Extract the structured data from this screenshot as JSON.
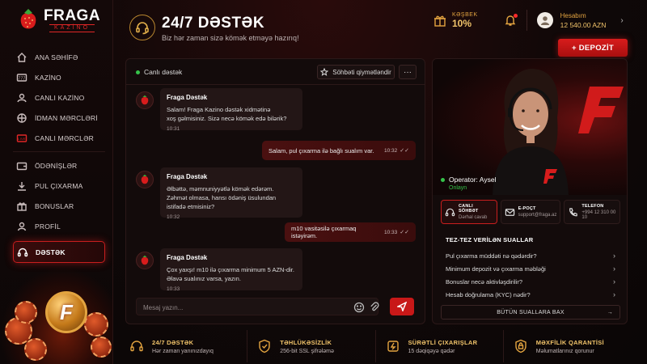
{
  "brand": {
    "name": "FRAGA",
    "sub": "KAZİNO"
  },
  "sidebar": {
    "items": [
      {
        "label": "ANA SƏHİFƏ",
        "icon": "home-icon"
      },
      {
        "label": "KAZİNO",
        "icon": "slot-icon"
      },
      {
        "label": "CANLI KAZİNO",
        "icon": "dealer-icon"
      },
      {
        "label": "İDMAN MƏRCLƏRİ",
        "icon": "sport-icon"
      },
      {
        "label": "CANLI MƏRCLƏR",
        "icon": "live-icon"
      },
      {
        "label": "ÖDƏNİŞLƏR",
        "icon": "wallet-icon"
      },
      {
        "label": "PUL ÇIXARMA",
        "icon": "withdraw-icon"
      },
      {
        "label": "BONUSLAR",
        "icon": "gift-icon"
      },
      {
        "label": "PROFİL",
        "icon": "user-icon"
      },
      {
        "label": "DƏSTƏK",
        "icon": "headset-icon"
      }
    ]
  },
  "header": {
    "title": "24/7 DƏSTƏK",
    "subtitle": "Biz hər zaman sizə kömək etməyə hazırıq!",
    "cashback_label": "KƏŞBEK",
    "cashback_value": "10%",
    "account_label": "Hesabım",
    "balance": "12 540.00 AZN",
    "deposit_label": "+ DEPOZİT"
  },
  "chat": {
    "status": "Canlı dəstək",
    "rate_label": "Söhbəti qiymətləndir",
    "more_label": "···",
    "messages": [
      {
        "from": "bot",
        "name": "Fraga Dəstək",
        "lines": [
          "Salam! Fraga Kazino dəstək xidmətinə",
          "xoş gəlmisiniz. Sizə necə kömək edə bilərik?"
        ],
        "time": "10:31"
      },
      {
        "from": "user",
        "text": "Salam, pul çıxarma ilə bağlı sualım var.",
        "time": "10:32"
      },
      {
        "from": "bot",
        "name": "Fraga Dəstək",
        "lines": [
          "Əlbəttə, məmnuniyyətlə kömək edərəm.",
          "Zəhmət olmasa, hansı ödəniş üsulundan",
          "istifadə etmisiniz?"
        ],
        "time": "10:32"
      },
      {
        "from": "user",
        "text": "m10 vasitəsilə çıxarmaq istəyirəm.",
        "time": "10:33"
      },
      {
        "from": "bot",
        "name": "Fraga Dəstək",
        "lines": [
          "Çox yaxşı! m10 ilə çıxarma minimum 5 AZN-dir.",
          "Əlavə sualınız varsa, yazın."
        ],
        "time": "10:33"
      }
    ],
    "input_placeholder": "Mesaj yazın..."
  },
  "operator": {
    "name": "Operator: Aysel",
    "status": "Onlayn",
    "contacts": [
      {
        "label": "CANLI SÖHBƏT",
        "value": "Dərhal cavab",
        "icon": "headset-icon"
      },
      {
        "label": "E-POÇT",
        "value": "support@fraga.az",
        "icon": "mail-icon"
      },
      {
        "label": "TELEFON",
        "value": "+994 12 310 00 10",
        "icon": "phone-icon"
      }
    ],
    "faq_title": "TEZ-TEZ VERİLƏN SUALLAR",
    "faq": [
      "Pul çıxarma müddəti nə qədərdir?",
      "Minimum depozit və çıxarma məbləği",
      "Bonuslar necə aktivləşdirilir?",
      "Hesab doğrulama (KYC) nədir?"
    ],
    "faq_all": "BÜTÜN SUALLARA BAX"
  },
  "footer": [
    {
      "label": "24/7 DƏSTƏK",
      "value": "Hər zaman yanınızdayıq",
      "icon": "headset-icon"
    },
    {
      "label": "TƏHLÜKƏSİZLİK",
      "value": "256-bit SSL şifrələmə",
      "icon": "shield-icon"
    },
    {
      "label": "SÜRƏTLİ ÇIXARIŞLAR",
      "value": "15 dəqiqəyə qədər",
      "icon": "fast-icon"
    },
    {
      "label": "MƏXFİLİK QARANTİSİ",
      "value": "Məlumatlarınız qorunur",
      "icon": "privacy-icon"
    }
  ],
  "colors": {
    "accent": "#c81e1e",
    "gold": "#e3a440",
    "online": "#35c24a"
  }
}
